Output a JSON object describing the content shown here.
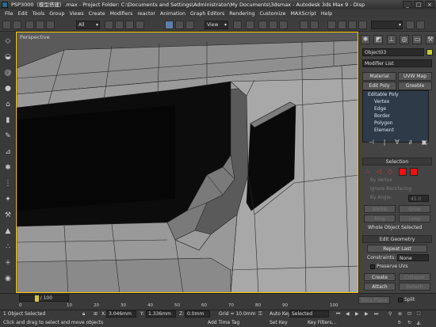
{
  "window": {
    "title": "PSP3000（模型搭建）.max   - Project Folder: C:\\Documents and Settings\\Administrator\\My Documents\\3dsmax    - Autodesk 3ds Max 9     - Disp",
    "controls": [
      "_",
      "□",
      "×"
    ]
  },
  "menu": [
    "File",
    "Edit",
    "Tools",
    "Group",
    "Views",
    "Create",
    "Modifiers",
    "reactor",
    "Animation",
    "Graph Editors",
    "Rendering",
    "Customize",
    "MAXScript",
    "Help"
  ],
  "toolbar": {
    "selection_filter": "All",
    "reference_coord": "View"
  },
  "viewport": {
    "label": "Perspective"
  },
  "command_panel": {
    "object_name": "Object03",
    "modifier_list": "Modifier List",
    "buttons": [
      "Material",
      "UVW Map",
      "Edit Poly",
      "Greeble"
    ],
    "stack": [
      "Editable Poly",
      "Vertex",
      "Edge",
      "Border",
      "Polygon",
      "Element"
    ],
    "selection_header": "Selection",
    "selection_options": [
      "By Vertex",
      "Ignore Backfacing",
      "By Angle:",
      "45.0"
    ],
    "grow_shrink": [
      "Shrink",
      "Grow",
      "Ring",
      "Loop"
    ],
    "whole_object": "Whole Object Selected",
    "edit_geometry_header": "Edit Geometry",
    "repeat_last": "Repeat Last",
    "constraints_label": "Constraints:",
    "constraints_value": "None",
    "preserve_uvs": "Preserve UVs",
    "create": "Create",
    "collapse": "Collapse",
    "attach": "Attach",
    "detach": "Detach",
    "slice_plane": "Slice Plane",
    "split": "Split"
  },
  "timeline": {
    "slider": "0 / 100",
    "ticks": [
      "0",
      "10",
      "20",
      "30",
      "40",
      "50",
      "60",
      "70",
      "80",
      "90",
      "100"
    ]
  },
  "status": {
    "selected": "1 Object Selected",
    "prompt": "Click and drag to select and move objects",
    "x_label": "X:",
    "x_value": "3.046mm",
    "y_label": "Y:",
    "y_value": "1.336mm",
    "z_label": "Z:",
    "z_value": "0.0mm",
    "grid": "Grid = 10.0mm",
    "add_time_tag": "Add Time Tag",
    "auto_key": "Auto Key",
    "set_key": "Set Key",
    "selected_dropdown": "Selected",
    "key_filters": "Key Filters..."
  }
}
